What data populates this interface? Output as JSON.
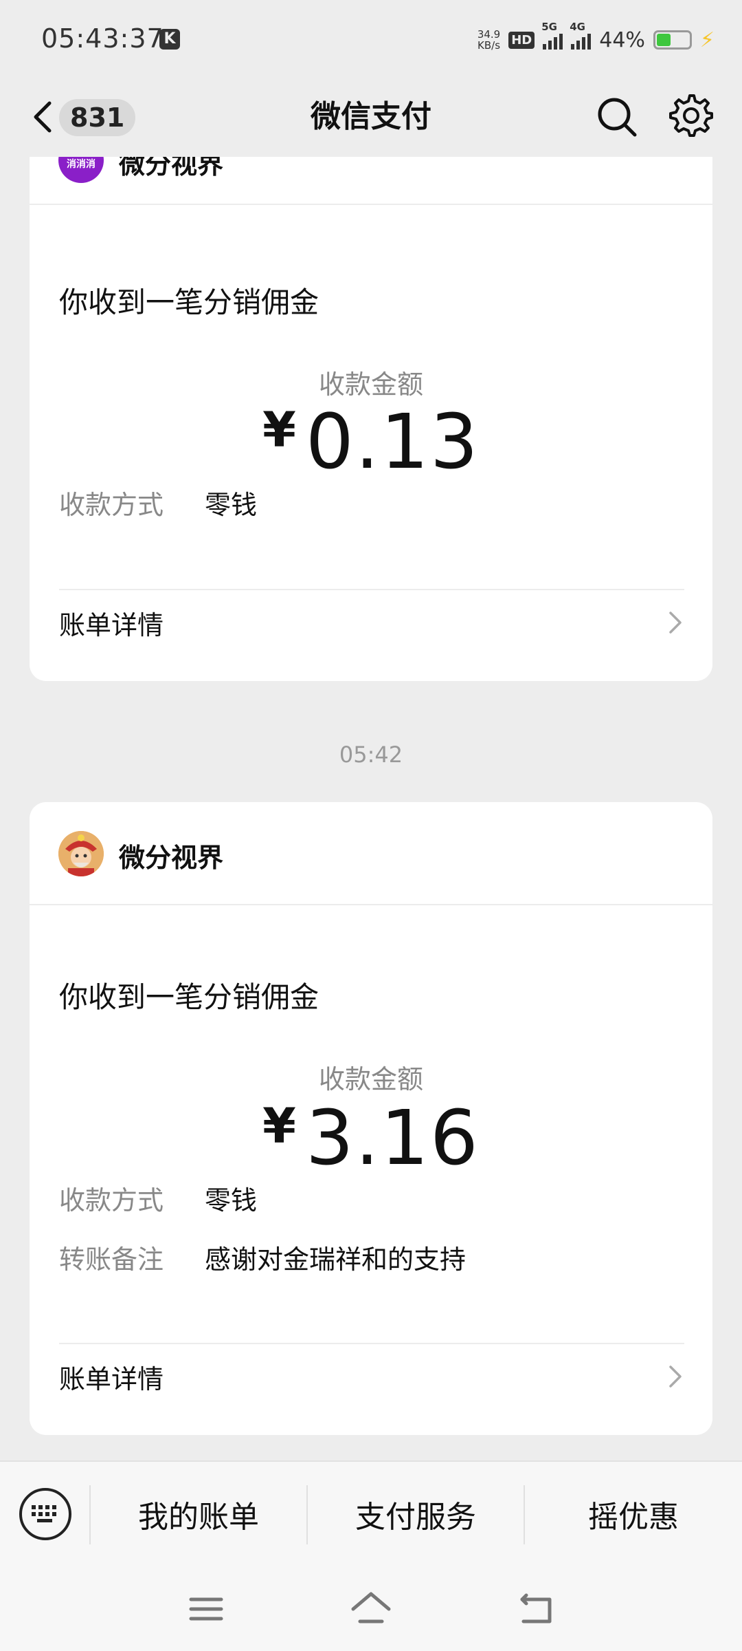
{
  "status_bar": {
    "time": "05:43:37",
    "k_badge": "K",
    "net_speed_value": "34.9",
    "net_speed_unit": "KB/s",
    "hd_label": "HD",
    "sim1_label": "5G",
    "sim2_label": "4G",
    "battery_percent": "44%",
    "battery_level": 0.44,
    "charging": true
  },
  "nav": {
    "back_label": "<",
    "unread_count": "831",
    "title": "微信支付"
  },
  "messages": [
    {
      "merchant": "微分视界",
      "avatar_text": "消消消",
      "title": "你收到一笔分销佣金",
      "amount_label": "收款金额",
      "currency": "¥",
      "amount": "0.13",
      "fields": [
        {
          "key": "收款方式",
          "value": "零钱"
        }
      ],
      "detail_label": "账单详情"
    },
    {
      "time": "05:42",
      "merchant": "微分视界",
      "title": "你收到一笔分销佣金",
      "amount_label": "收款金额",
      "currency": "¥",
      "amount": "3.16",
      "fields": [
        {
          "key": "收款方式",
          "value": "零钱"
        },
        {
          "key": "转账备注",
          "value": "感谢对金瑞祥和的支持"
        }
      ],
      "detail_label": "账单详情"
    }
  ],
  "bottom_menu": {
    "items": [
      "我的账单",
      "支付服务",
      "摇优惠"
    ]
  },
  "colors": {
    "background": "#ededed",
    "card": "#ffffff",
    "muted_text": "#888888",
    "battery_green": "#3ec73e",
    "bolt_yellow": "#f6c52b",
    "avatar1_purple": "#8a1fc8"
  }
}
